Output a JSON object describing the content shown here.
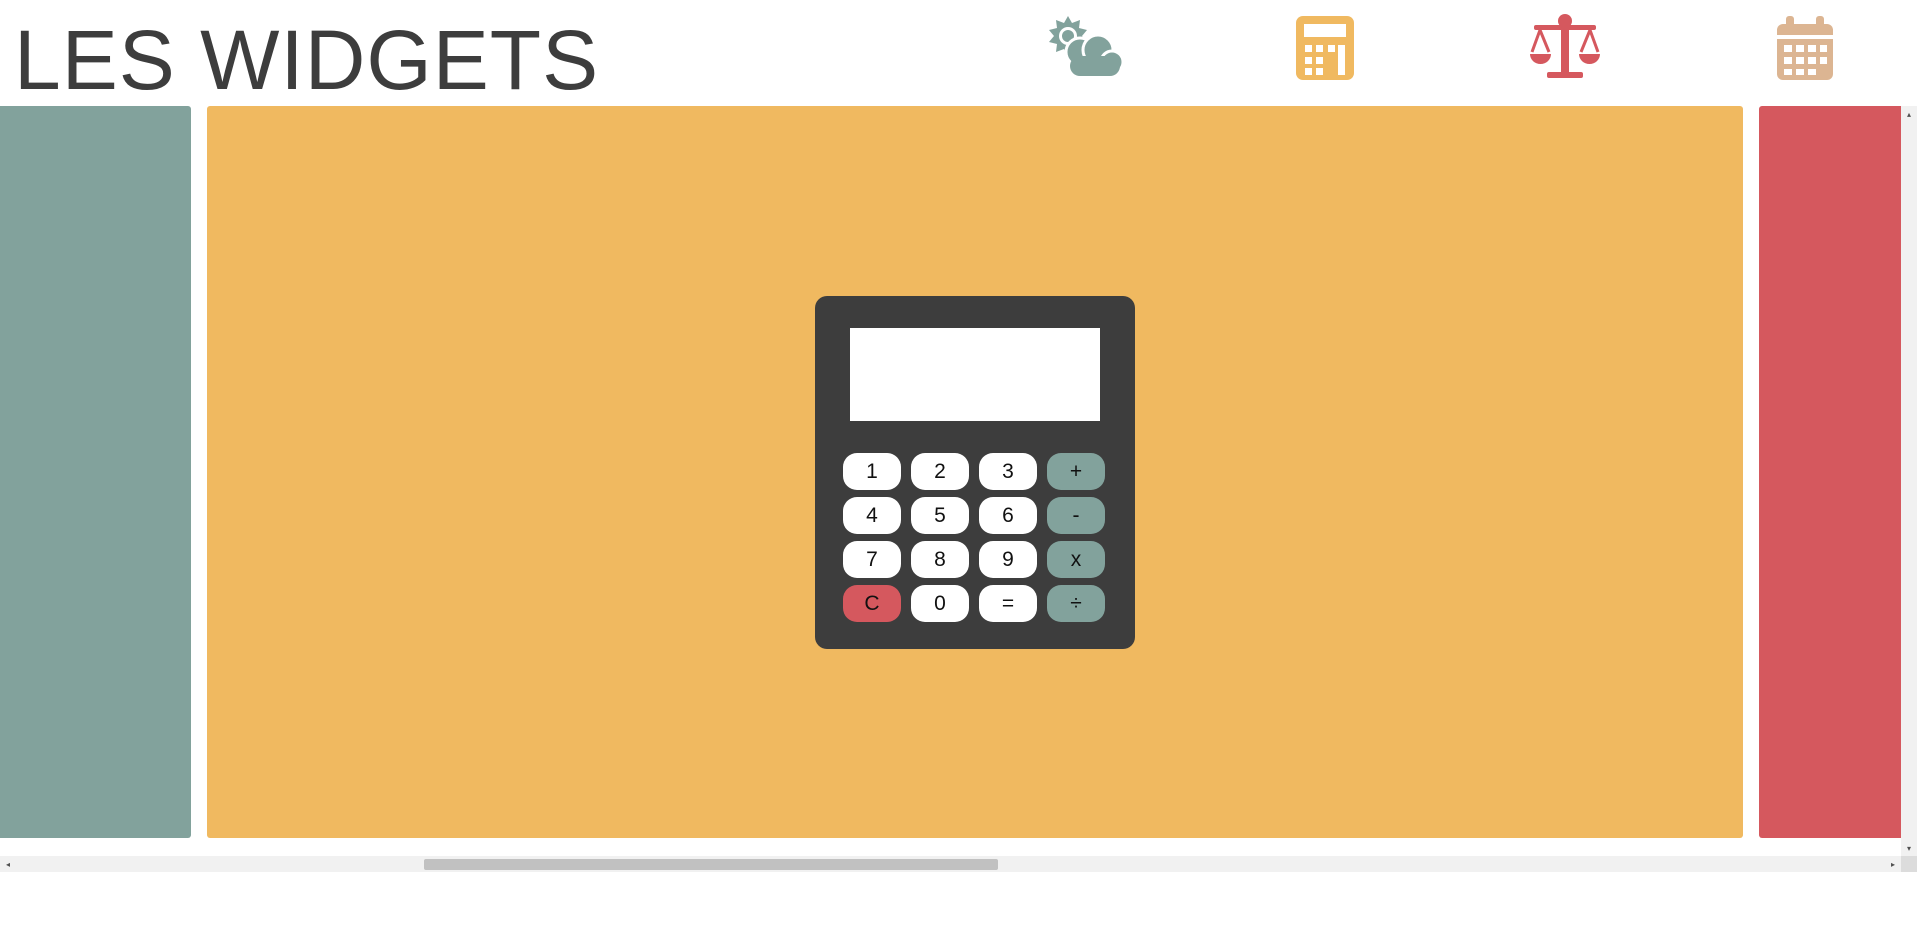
{
  "header": {
    "title": "LES WIDGETS",
    "nav": [
      {
        "icon": "weather-icon",
        "color": "#82a29c"
      },
      {
        "icon": "calculator-icon",
        "color": "#f0b960"
      },
      {
        "icon": "scale-icon",
        "color": "#d5585e"
      },
      {
        "icon": "calendar-icon",
        "color": "#dcb592"
      }
    ]
  },
  "panels": {
    "left_color": "#82a29c",
    "center_color": "#f0b960",
    "right_color": "#d5585e"
  },
  "calculator": {
    "display_value": "",
    "body_color": "#3d3d3d",
    "keys": [
      {
        "label": "1",
        "type": "digit"
      },
      {
        "label": "2",
        "type": "digit"
      },
      {
        "label": "3",
        "type": "digit"
      },
      {
        "label": "+",
        "type": "operator"
      },
      {
        "label": "4",
        "type": "digit"
      },
      {
        "label": "5",
        "type": "digit"
      },
      {
        "label": "6",
        "type": "digit"
      },
      {
        "label": "-",
        "type": "operator"
      },
      {
        "label": "7",
        "type": "digit"
      },
      {
        "label": "8",
        "type": "digit"
      },
      {
        "label": "9",
        "type": "digit"
      },
      {
        "label": "x",
        "type": "operator"
      },
      {
        "label": "C",
        "type": "clear"
      },
      {
        "label": "0",
        "type": "digit"
      },
      {
        "label": "=",
        "type": "equals"
      },
      {
        "label": "÷",
        "type": "operator"
      }
    ],
    "key_colors": {
      "digit": "#ffffff",
      "equals": "#ffffff",
      "operator": "#82a29c",
      "clear": "#d5585e"
    }
  },
  "scrollbars": {
    "left_arrow": "◂",
    "right_arrow": "▸",
    "up_arrow": "▴",
    "down_arrow": "▾"
  }
}
